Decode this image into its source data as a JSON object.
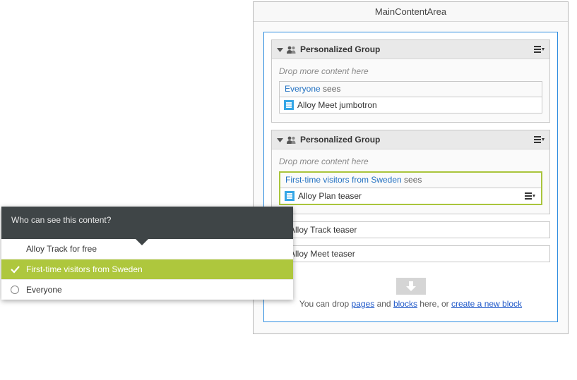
{
  "panel": {
    "title": "MainContentArea"
  },
  "groups": [
    {
      "title": "Personalized Group",
      "drop_hint": "Drop more content here",
      "segment": {
        "name": "Everyone",
        "sees": "sees",
        "highlighted": false
      },
      "block": "Alloy Meet jumbotron"
    },
    {
      "title": "Personalized Group",
      "drop_hint": "Drop more content here",
      "segment": {
        "name": "First-time visitors from Sweden",
        "sees": "sees",
        "highlighted": true
      },
      "block": "Alloy Plan teaser"
    }
  ],
  "rows": [
    {
      "name": "Alloy Track teaser"
    },
    {
      "name": "Alloy Meet teaser"
    }
  ],
  "dropzone": {
    "pre": "You can drop ",
    "link1": "pages",
    "mid1": " and ",
    "link2": "blocks",
    "mid2": " here, or ",
    "link3": "create a new block"
  },
  "popup": {
    "title": "Who can see this content?",
    "items": [
      {
        "label": "Alloy Track for free",
        "state": "blank"
      },
      {
        "label": "First-time visitors from Sweden",
        "state": "selected"
      },
      {
        "label": "Everyone",
        "state": "radio"
      }
    ]
  }
}
